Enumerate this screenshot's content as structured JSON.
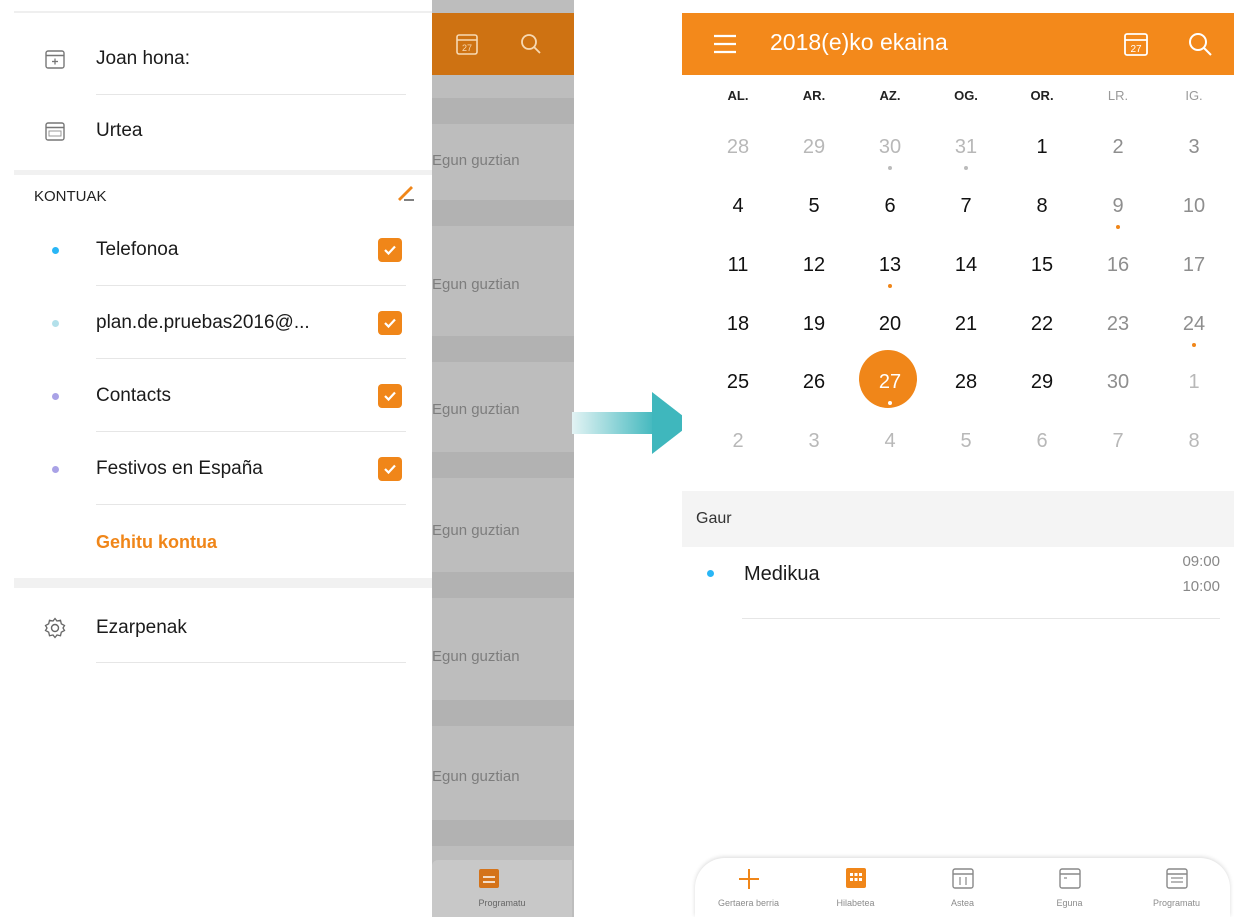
{
  "left_screen": {
    "drawer": {
      "items_top": [
        {
          "label": "Joan hona:",
          "icon": "calendar-goto-icon"
        },
        {
          "label": "Urtea",
          "icon": "calendar-year-icon"
        }
      ],
      "accounts_header": "KONTUAK",
      "accounts": [
        {
          "label": "Telefonoa",
          "dot_color": "#29b6f6",
          "checked": true
        },
        {
          "label": "plan.de.pruebas2016@...",
          "dot_color": "#b3e0ea",
          "checked": true
        },
        {
          "label": "Contacts",
          "dot_color": "#a9a2e6",
          "checked": true
        },
        {
          "label": "Festivos en España",
          "dot_color": "#a9a2e6",
          "checked": true
        }
      ],
      "add_account": "Gehitu kontua",
      "settings": "Ezarpenak"
    },
    "overlay": {
      "entries": [
        "Egun guztian",
        "Egun guztian",
        "Egun guztian",
        "Egun guztian",
        "Egun guztian",
        "Egun guztian"
      ],
      "bottom_label": "Programatu"
    }
  },
  "right_screen": {
    "title": "2018(e)ko ekaina",
    "header_calendar_day": "27",
    "weekdays": [
      "AL.",
      "AR.",
      "AZ.",
      "OG.",
      "OR.",
      "LR.",
      "IG."
    ],
    "weeks": [
      [
        "28",
        "29",
        "30",
        "31",
        "1",
        "2",
        "3"
      ],
      [
        "4",
        "5",
        "6",
        "7",
        "8",
        "9",
        "10"
      ],
      [
        "11",
        "12",
        "13",
        "14",
        "15",
        "16",
        "17"
      ],
      [
        "18",
        "19",
        "20",
        "21",
        "22",
        "23",
        "24"
      ],
      [
        "25",
        "26",
        "27",
        "28",
        "29",
        "30",
        "1"
      ],
      [
        "2",
        "3",
        "4",
        "5",
        "6",
        "7",
        "8"
      ]
    ],
    "selected_day": "27",
    "today_section": "Gaur",
    "event": {
      "title": "Medikua",
      "start": "09:00",
      "end": "10:00",
      "dot_color": "#29b6f6"
    },
    "bottom_nav": [
      {
        "label": "Gertaera berria",
        "icon": "plus-icon"
      },
      {
        "label": "Hilabetea",
        "icon": "month-view-icon",
        "active": true
      },
      {
        "label": "Astea",
        "icon": "week-view-icon"
      },
      {
        "label": "Eguna",
        "icon": "day-view-icon"
      },
      {
        "label": "Programatu",
        "icon": "agenda-view-icon"
      }
    ]
  },
  "colors": {
    "accent": "#f3891b",
    "overlay_gray": "#bdbdbd",
    "arrow": "#3fb7bd"
  }
}
